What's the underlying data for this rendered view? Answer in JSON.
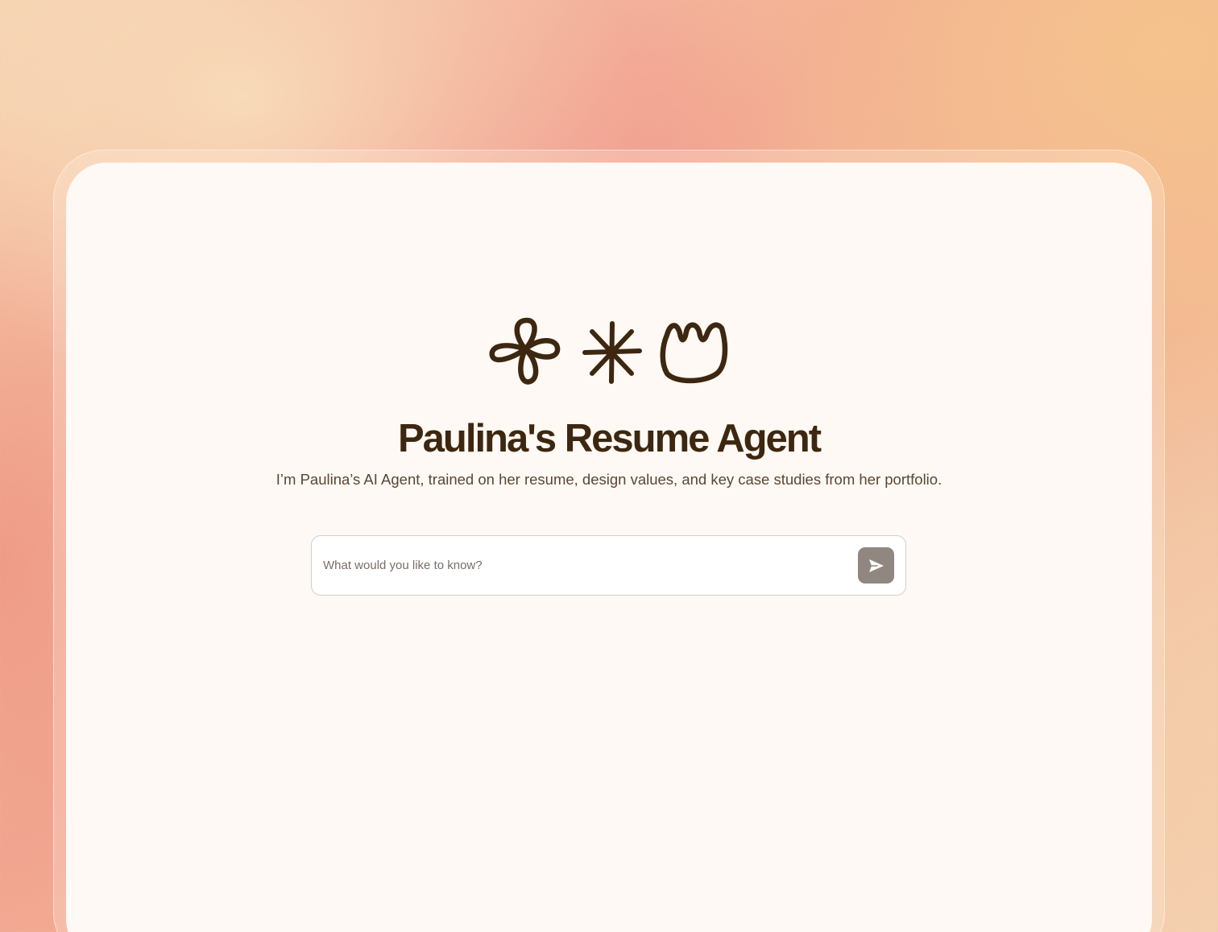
{
  "header": {
    "logo_icons": [
      "flower-doodle-icon",
      "asterisk-doodle-icon",
      "tulip-doodle-icon"
    ],
    "title": "Paulina's Resume Agent",
    "subtitle": "I’m Paulina’s AI Agent, trained on her resume, design values, and key case studies from her portfolio."
  },
  "chat": {
    "placeholder": "What would you like to know?",
    "value": "",
    "send_icon": "send-arrow-icon"
  },
  "colors": {
    "brand_text": "#3d2710",
    "card_background": "#fef9f4",
    "send_button": "#8f8780"
  }
}
